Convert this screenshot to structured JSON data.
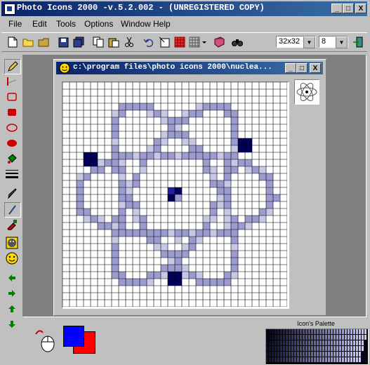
{
  "app": {
    "title": "Photo Icons 2000 -v.5.2.002 -  (UNREGISTERED COPY)",
    "window_buttons": [
      "_",
      "□",
      "X"
    ]
  },
  "menu": [
    "File",
    "Edit",
    "Tools",
    "Options",
    "Window",
    "Help"
  ],
  "toolbar": {
    "size_value": "32x32",
    "depth_value": "8",
    "icons": [
      "new-icon",
      "open-icon",
      "folder-icon",
      "save-icon",
      "save-all-icon",
      "copy-icon",
      "paste-icon",
      "cut-icon",
      "undo-icon",
      "import-icon",
      "grid-icon",
      "grid-options-icon",
      "book-icon",
      "find-icon",
      "exit-icon"
    ]
  },
  "left_tools": [
    "pencil-icon",
    "line-icon",
    "rect-outline-icon",
    "rect-filled-icon",
    "ellipse-outline-icon",
    "ellipse-filled-icon",
    "fill-icon",
    "line-width-icon",
    "brush-icon",
    "pen-icon",
    "dropper-icon",
    "smiley-icon",
    "smiley-yellow-icon",
    "arrow-left-icon",
    "arrow-right-icon",
    "arrow-up-icon",
    "arrow-down-icon"
  ],
  "child_window": {
    "title": "c:\\program files\\photo icons 2000\\nuclea..."
  },
  "colors": {
    "foreground": "#0000ff",
    "background": "#ff0000",
    "grid_line": "#000000",
    "pixel_light": "#c8c8e6",
    "pixel_mid": "#9b9bd0",
    "pixel_dark": "#2020a0",
    "pixel_darkest": "#00005a"
  },
  "palette": {
    "label": "Icon's Palette"
  }
}
